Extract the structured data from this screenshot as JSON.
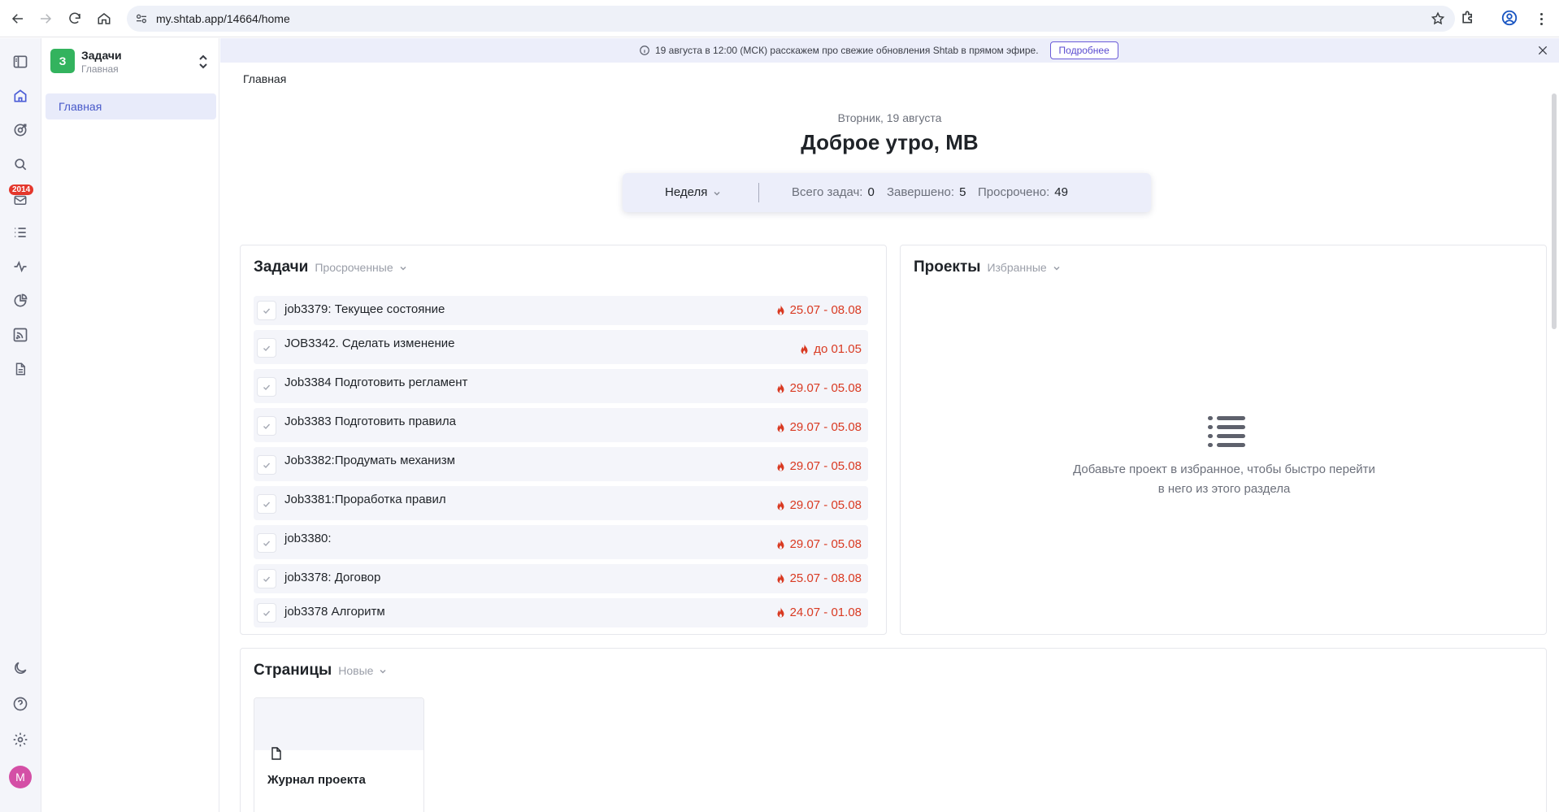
{
  "browser": {
    "url": "my.shtab.app/14664/home"
  },
  "rail": {
    "inbox_badge": "2014",
    "avatar_letter": "M"
  },
  "workspace": {
    "logo_letter": "З",
    "name": "Задачи",
    "subtitle": "Главная"
  },
  "sidebar": {
    "items": [
      {
        "label": "Главная"
      }
    ]
  },
  "announcement": {
    "text": "19 августа в 12:00 (МСК) расскажем про свежие обновления Shtab в прямом эфире.",
    "button": "Подробнее"
  },
  "breadcrumb": "Главная",
  "header": {
    "date": "Вторник, 19 августа",
    "greeting": "Доброе утро, МВ"
  },
  "stats": {
    "period": "Неделя",
    "total_label": "Всего задач:",
    "total_value": "0",
    "done_label": "Завершено:",
    "done_value": "5",
    "overdue_label": "Просрочено:",
    "overdue_value": "49"
  },
  "tasks_card": {
    "title": "Задачи",
    "filter": "Просроченные",
    "items": [
      {
        "name": "job3379: Текущее состояние",
        "due": "25.07 - 08.08"
      },
      {
        "name": "JOB3342. Сделать изменение",
        "due": "до 01.05"
      },
      {
        "name": "Job3384 Подготовить регламент",
        "due": "29.07 - 05.08"
      },
      {
        "name": "Job3383 Подготовить правила",
        "due": "29.07 - 05.08"
      },
      {
        "name": "Job3382:Продумать механизм",
        "due": "29.07 - 05.08"
      },
      {
        "name": "Job3381:Проработка правил",
        "due": "29.07 - 05.08"
      },
      {
        "name": "job3380:",
        "due": "29.07 - 05.08"
      },
      {
        "name": "job3378: Договор",
        "due": "25.07 - 08.08"
      },
      {
        "name": "job3378 Алгоритм",
        "due": "24.07 - 01.08"
      }
    ]
  },
  "projects_card": {
    "title": "Проекты",
    "filter": "Избранные",
    "empty_line1": "Добавьте проект в избранное, чтобы быстро перейти",
    "empty_line2": "в него из этого раздела"
  },
  "pages_card": {
    "title": "Страницы",
    "filter": "Новые",
    "items": [
      {
        "name": "Журнал проекта"
      }
    ]
  },
  "colors": {
    "accent": "#4a5cd6",
    "overdue": "#d93a22",
    "workspace_logo": "#33b35e"
  }
}
